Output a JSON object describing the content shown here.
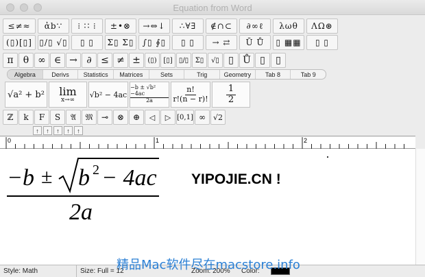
{
  "window": {
    "title": "Equation from Word"
  },
  "toolbar_row1": [
    "≤≠≈",
    "ἀb∵",
    "⁞ ∷ ⁞",
    "±•⊗",
    "→⇔↓",
    "∴∀∃",
    "∉∩⊂",
    "∂∞ℓ",
    "λωθ",
    "ΛΩ⊛"
  ],
  "toolbar_row2": [
    "(▯)[▯]",
    "▯/▯ √▯",
    "▯ ▯",
    "Σ▯ Σ▯",
    "∫▯ ∮▯",
    "▯ ▯",
    "→ ⇄",
    "Ū Ů",
    "▯ ▦▦",
    "▯ ▯"
  ],
  "toolbar_row3": [
    "π",
    "θ",
    "∞",
    "∈",
    "→",
    "∂",
    "≤",
    "≠",
    "±",
    "(▯)",
    "[▯]",
    "▯/▯",
    "Σ▯",
    "√▯",
    "▯",
    "Ů",
    "▯",
    "▯"
  ],
  "tabs": [
    "Algebra",
    "Derivs",
    "Statistics",
    "Matrices",
    "Sets",
    "Trig",
    "Geometry",
    "Tab 8",
    "Tab 9"
  ],
  "templates": {
    "t1": "√a² + b²",
    "t2_top": "lim",
    "t2_bottom": "x→∞",
    "t3": "√b² − 4ac",
    "t4_top": "−b ± √b² −4ac",
    "t4_bottom": "2a",
    "t5_top": "n!",
    "t5_bottom": "r!(n − r)!",
    "t6_top": "1",
    "t6_bottom": "2"
  },
  "toolbar_row5": [
    "ℤ",
    "k",
    "F",
    "S",
    "𝔄",
    "𝔐",
    "⊸",
    "⊗",
    "⊕",
    "◁",
    "▷",
    "[0,1]",
    "∞",
    "√2"
  ],
  "ruler_arrows": [
    "↑",
    "↑",
    "↑",
    "↑",
    "↑"
  ],
  "ruler_labels": [
    "0",
    "1",
    "2"
  ],
  "equation": {
    "numerator_lead": "−b",
    "pm": "±",
    "radicand_b": "b",
    "radicand_exp": "2",
    "radicand_rest": "− 4ac",
    "denominator": "2a"
  },
  "overlay_text": "YIPOJIE.CN !",
  "status": {
    "style": "Style: Math",
    "size": "Size: Full = 12",
    "zoom": "Zoom: 200%",
    "color": "Color:"
  },
  "watermark": "精品Mac软件尽在macstore.info",
  "colors": {
    "watermark": "#2a7fd4",
    "color_swatch": "#000000"
  }
}
